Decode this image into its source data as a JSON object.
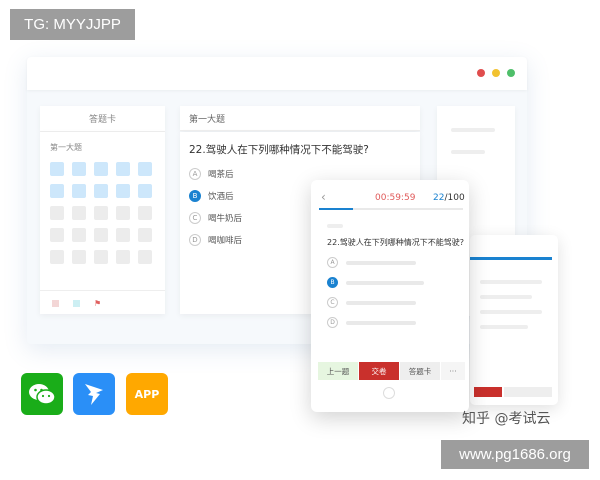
{
  "watermark": {
    "top_left": "TG: MYYJJPP",
    "bottom_right": "www.pg1686.org",
    "zhihu": "知乎 @考试云"
  },
  "window": {
    "dots": [
      "#e04d4d",
      "#f2c230",
      "#4fbf6a"
    ]
  },
  "answer_card": {
    "title": "答题卡",
    "section": "第一大题",
    "cells": [
      [
        "answered",
        "answered",
        "answered",
        "answered",
        "answered"
      ],
      [
        "answered",
        "answered",
        "answered",
        "answered",
        "answered"
      ],
      [
        "empty",
        "empty",
        "empty",
        "empty",
        "empty"
      ],
      [
        "empty",
        "empty",
        "empty",
        "empty",
        "empty"
      ],
      [
        "empty",
        "empty",
        "empty",
        "empty",
        "empty"
      ]
    ],
    "legend_icons": [
      "empty-square-icon",
      "answered-square-icon",
      "flag-icon"
    ]
  },
  "question": {
    "section": "第一大题",
    "title": "22.驾驶人在下列哪种情况下不能驾驶?",
    "options": [
      {
        "letter": "A",
        "text": "喝茶后",
        "selected": false
      },
      {
        "letter": "B",
        "text": "饮酒后",
        "selected": true
      },
      {
        "letter": "C",
        "text": "喝牛奶后",
        "selected": false
      },
      {
        "letter": "D",
        "text": "喝咖啡后",
        "selected": false
      }
    ]
  },
  "phone": {
    "back_icon": "‹",
    "timer": "00:59:59",
    "counter_current": "22",
    "counter_total": "/100",
    "question": "22.驾驶人在下列哪种情况下不能驾驶?",
    "options": [
      "A",
      "B",
      "C",
      "D"
    ],
    "selected_option": "B",
    "buttons": {
      "prev": "上一题",
      "submit": "交卷",
      "card": "答题卡",
      "more": "···"
    }
  },
  "apps": {
    "app_label": "APP",
    "icons": [
      "wechat-icon",
      "dingtalk-icon",
      "app-icon"
    ]
  },
  "colors": {
    "accent": "#1a82d0",
    "submit": "#c9302c",
    "wechat": "#1aad19",
    "dingtalk": "#2a8ff7",
    "app": "#ffa800"
  }
}
